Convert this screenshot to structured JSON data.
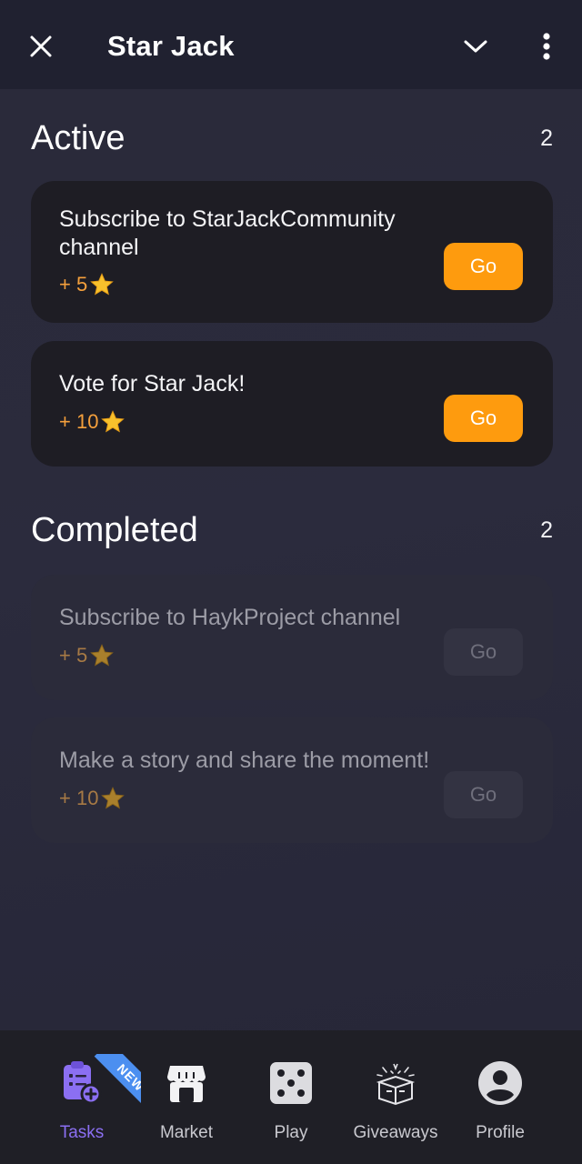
{
  "header": {
    "title": "Star Jack",
    "close_icon": "close-icon",
    "collapse_icon": "chevron-down-icon",
    "menu_icon": "more-vertical-icon"
  },
  "active": {
    "heading": "Active",
    "count": "2",
    "tasks": [
      {
        "title": "Subscribe to StarJackCommunity channel",
        "reward": "+ 5",
        "button": "Go"
      },
      {
        "title": "Vote for Star Jack!",
        "reward": "+ 10",
        "button": "Go"
      }
    ]
  },
  "completed": {
    "heading": "Completed",
    "count": "2",
    "tasks": [
      {
        "title": "Subscribe to HaykProject channel",
        "reward": "+ 5",
        "button": "Go"
      },
      {
        "title": "Make a story and share the moment!",
        "reward": "+ 10",
        "button": "Go"
      }
    ]
  },
  "nav": {
    "items": [
      {
        "label": "Tasks",
        "icon": "tasks-clipboard-icon",
        "badge": "NEW",
        "active": true
      },
      {
        "label": "Market",
        "icon": "market-store-icon"
      },
      {
        "label": "Play",
        "icon": "dice-icon"
      },
      {
        "label": "Giveaways",
        "icon": "gift-box-icon"
      },
      {
        "label": "Profile",
        "icon": "profile-avatar-icon"
      }
    ]
  },
  "colors": {
    "accent_orange": "#fe9b0e",
    "reward_text": "#f5a03c",
    "active_nav": "#8b6ff2",
    "background": "#2a2a39"
  }
}
